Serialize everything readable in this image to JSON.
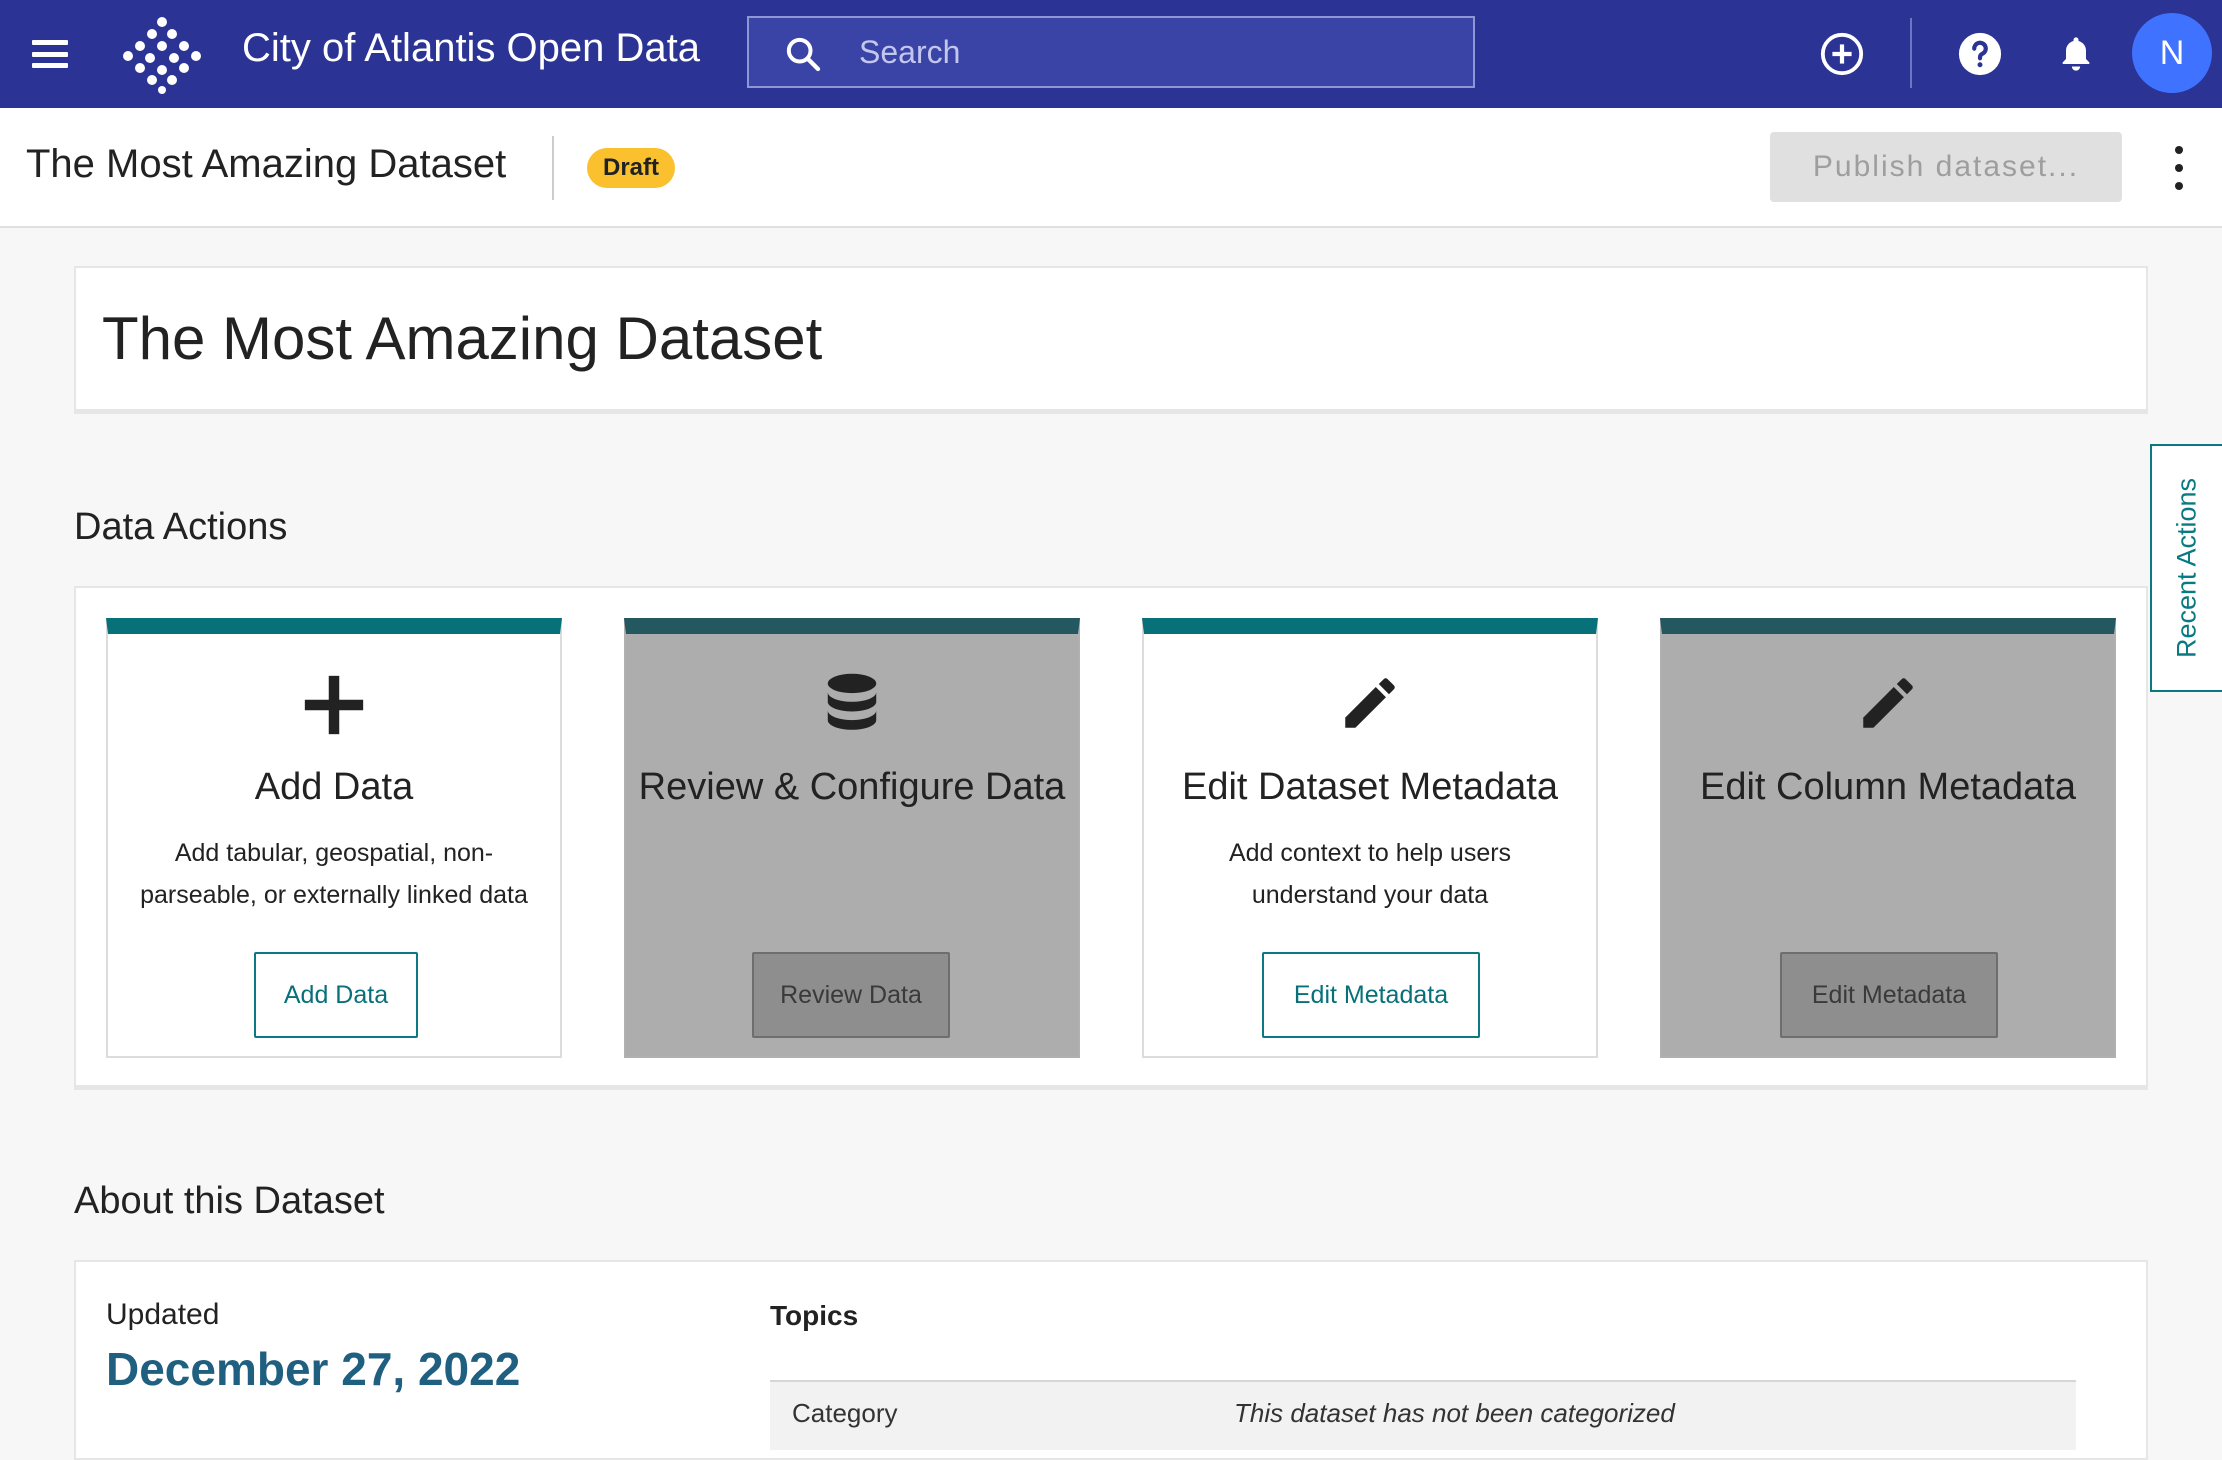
{
  "header": {
    "app_title": "City of Atlantis Open Data",
    "search_placeholder": "Search",
    "avatar_initial": "N",
    "brand_color": "#2b3394"
  },
  "subheader": {
    "dataset_title": "The Most Amazing Dataset",
    "status_badge": "Draft",
    "publish_label": "Publish dataset..."
  },
  "main": {
    "dataset_title": "The Most Amazing Dataset",
    "data_actions": {
      "heading": "Data Actions",
      "cards": [
        {
          "icon": "plus-icon",
          "title": "Add Data",
          "description": "Add tabular, geospatial, non-parseable, or externally linked data",
          "button": "Add Data",
          "enabled": true
        },
        {
          "icon": "database-icon",
          "title": "Review & Configure Data",
          "description": "",
          "button": "Review Data",
          "enabled": false
        },
        {
          "icon": "pencil-icon",
          "title": "Edit Dataset Metadata",
          "description": "Add context to help users understand your data",
          "button": "Edit Metadata",
          "enabled": true
        },
        {
          "icon": "pencil-icon",
          "title": "Edit Column Metadata",
          "description": "",
          "button": "Edit Metadata",
          "enabled": false
        }
      ]
    },
    "about": {
      "heading": "About this Dataset",
      "updated_label": "Updated",
      "updated_date": "December 27, 2022",
      "topics_heading": "Topics",
      "topics": [
        {
          "key": "Category",
          "value": "This dataset has not been categorized"
        }
      ]
    }
  },
  "recent_actions_tab": "Recent Actions",
  "accent_color": "#087078"
}
